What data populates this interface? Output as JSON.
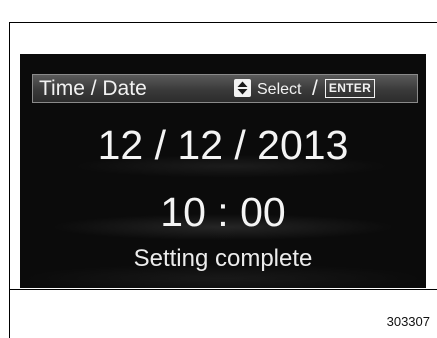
{
  "header": {
    "title": "Time / Date",
    "updown_icon": "up-down-arrow-icon",
    "select_label": "Select",
    "separator": "/",
    "enter_label": "ENTER"
  },
  "display": {
    "date": "12 / 12 / 2013",
    "time": "10 : 00",
    "status": "Setting complete"
  },
  "figure": {
    "number": "303307"
  },
  "colors": {
    "screen_background": "#0b0b0b",
    "header_bar": "#3a3a3a",
    "text": "#f2f2f2"
  }
}
